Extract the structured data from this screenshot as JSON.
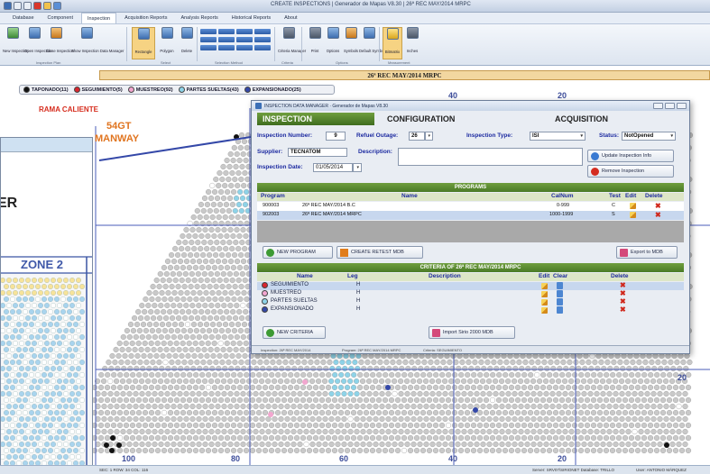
{
  "window": {
    "title": "CREATE INSPECTIONS | Generador de Mapas V8.30 | 26ª REC MAY/2014 MRPC"
  },
  "menu": [
    "Database",
    "Component",
    "Inspection",
    "Acquisition Reports",
    "Analysis Reports",
    "Historical Reports",
    "About"
  ],
  "ribbon": {
    "buttons": [
      "New Inspection",
      "Open Inspection",
      "Close Inspection",
      "Show Inspection Data Manager",
      "Rectangle",
      "Polygon",
      "Delete",
      "Selection Method",
      "Criteria Manager",
      "Print",
      "Options",
      "Symbols",
      "Default Symbols",
      "Bitmatrix",
      "Inches"
    ],
    "groups": [
      "Inspection Plan",
      "Select",
      "Selection Method",
      "Criteria",
      "Options",
      "Measurement"
    ]
  },
  "banner": "26ª REC MAY/2014 MRPC",
  "legend": [
    {
      "label": "TAPONADO(11)",
      "color": "#111111"
    },
    {
      "label": "SEGUIMIENTO(5)",
      "color": "#d9262e"
    },
    {
      "label": "MUESTREO(92)",
      "color": "#f2a6cf"
    },
    {
      "label": "PARTES SUELTAS(43)",
      "color": "#8ed3e8"
    },
    {
      "label": "EXPANSIONADO(25)",
      "color": "#3448a8"
    }
  ],
  "map": {
    "title_left": "RAMA CALIENTE",
    "label_gt": "54GT",
    "label_manway": "MANWAY",
    "axis_top": [
      "40",
      "20"
    ],
    "axis_bottom": [
      "100",
      "80",
      "60",
      "40",
      "20"
    ],
    "axis_right": "20"
  },
  "left_doc": {
    "big_text": "ER",
    "zone": "ZONE 2"
  },
  "dialog": {
    "title": "INSPECTION DATA MANAGER · Generador de Mapas V8.30",
    "tabs": [
      "INSPECTION",
      "CONFIGURATION",
      "ACQUISITION"
    ],
    "inspection_number_label": "Inspection Number:",
    "inspection_number": "9",
    "refuel_outage_label": "Refuel Outage:",
    "refuel_outage": "26",
    "inspection_type_label": "Inspection Type:",
    "inspection_type": "ISI",
    "status_label": "Status:",
    "status": "NotOpened",
    "supplier_label": "Supplier:",
    "supplier": "TECNATOM",
    "description_label": "Description:",
    "inspection_date_label": "Inspection Date:",
    "inspection_date": "01/05/2014",
    "update_btn": "Update Inspection Info",
    "remove_btn": "Remove Inspection",
    "programs_header": "PROGRAMS",
    "programs_columns": [
      "Program",
      "Name",
      "CalNum",
      "Test",
      "Edit",
      "Delete"
    ],
    "programs": [
      {
        "program": "900003",
        "name": "26ª REC MAY/2014 B.C",
        "calnum": "0-999",
        "test": "C"
      },
      {
        "program": "902003",
        "name": "26ª REC MAY/2014 MRPC",
        "calnum": "1000-1999",
        "test": "S"
      }
    ],
    "new_program_btn": "NEW PROGRAM",
    "create_retest_btn": "CREATE RETEST MDB",
    "export_btn": "Export to MDB",
    "criteria_header": "CRITERIA OF 26ª REC MAY/2014 MRPC",
    "criteria_columns": [
      "Name",
      "Leg",
      "Description",
      "Edit",
      "Clear",
      "Delete"
    ],
    "criteria": [
      {
        "name": "SEGUIMIENTO",
        "leg": "H",
        "color": "#d9262e"
      },
      {
        "name": "MUESTREO",
        "leg": "H",
        "color": "#f2a6cf"
      },
      {
        "name": "PARTES SUELTAS",
        "leg": "H",
        "color": "#8ed3e8"
      },
      {
        "name": "EXPANSIONADO",
        "leg": "H",
        "color": "#3448a8"
      }
    ],
    "new_criteria_btn": "NEW CRITERIA",
    "import_btn": "Import Sirio 2000 MDB",
    "status_bar": [
      "Inspection: 26ª REC MAY/2014",
      "Program: 26ª REC MAY/2014 MRPC",
      "Criteria: SEGUIMIENTO"
    ]
  },
  "statusbar": [
    "SEC: 1 ROW: 34 COL: 116",
    "Server: SRV07\\SIRIONET  Database: TRILLO",
    "User: ANTONIO MÁRQUEZ"
  ]
}
